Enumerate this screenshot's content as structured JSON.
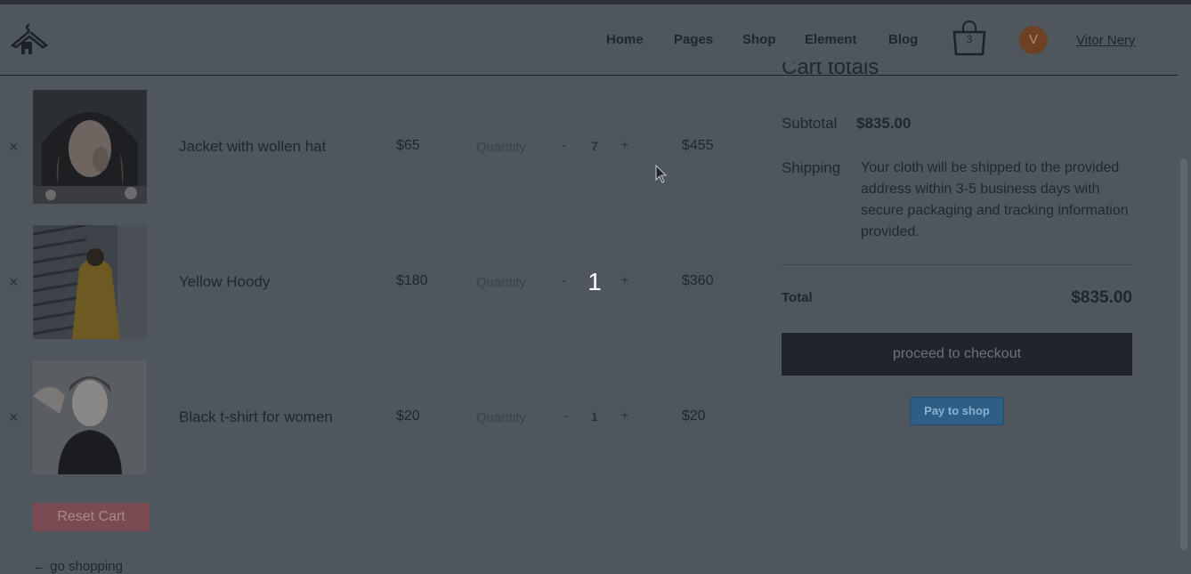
{
  "header": {
    "nav": [
      "Home",
      "Pages",
      "Shop",
      "Element",
      "Blog"
    ],
    "cart_count": "3",
    "avatar_initial": "V",
    "username": "Vitor Nery"
  },
  "cart": {
    "items": [
      {
        "name": "Jacket with wollen hat",
        "price": "$65",
        "quantity_label": "Quantity",
        "minus": "-",
        "qty": "7",
        "plus": "+",
        "subtotal": "$455"
      },
      {
        "name": "Yellow Hoody",
        "price": "$180",
        "quantity_label": "Quantity",
        "minus": "-",
        "qty": "1",
        "plus": "+",
        "subtotal": "$360"
      },
      {
        "name": "Black t-shirt for women",
        "price": "$20",
        "quantity_label": "Quantity",
        "minus": "-",
        "qty": "1",
        "plus": "+",
        "subtotal": "$20"
      }
    ],
    "remove_icon": "×",
    "reset_label": "Reset Cart",
    "continue_label": "← go shopping"
  },
  "totals": {
    "title": "Cart totals",
    "subtotal_label": "Subtotal",
    "subtotal_value": "$835.00",
    "shipping_label": "Shipping",
    "shipping_text": "Your cloth will be shipped to the provided address within 3-5 business days with secure packaging and tracking information provided.",
    "total_label": "Total",
    "total_value": "$835.00",
    "checkout_label": "proceed to checkout",
    "pay_label": "Pay to shop"
  },
  "colors": {
    "overlay_bg": "#4f565d",
    "reset_button": "#7a4b52",
    "checkout_button": "#1f252b",
    "pay_button": "#2d5f86",
    "avatar": "#6d4224"
  }
}
